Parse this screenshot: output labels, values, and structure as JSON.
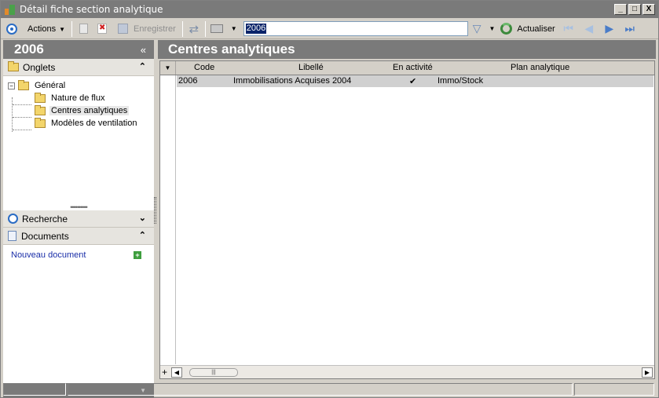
{
  "window": {
    "title": "Détail fiche section analytique",
    "controls": [
      "_",
      "□",
      "X"
    ]
  },
  "toolbar": {
    "actions_label": "Actions",
    "save_label": "Enregistrer",
    "search_value": "2006",
    "refresh_label": "Actualiser"
  },
  "left": {
    "header_title": "2006",
    "collapse_glyph": "«",
    "onglets_label": "Onglets",
    "tree": {
      "root": "Général",
      "children": [
        "Nature de flux",
        "Centres analytiques",
        "Modèles de ventilation"
      ],
      "selected": "Centres analytiques"
    },
    "recherche_label": "Recherche",
    "documents_label": "Documents",
    "new_document_label": "Nouveau document"
  },
  "grid": {
    "title": "Centres analytiques",
    "columns": [
      "Code",
      "Libellé",
      "En activité",
      "Plan analytique"
    ],
    "rows": [
      {
        "code": "2006",
        "libelle": "Immobilisations Acquises 2004",
        "active": "✔",
        "plan": "Immo/Stock"
      }
    ]
  },
  "colors": {
    "header_gray": "#7a7a7a",
    "accent_blue": "#2a6cc4",
    "link_blue": "#1a2ea8"
  }
}
